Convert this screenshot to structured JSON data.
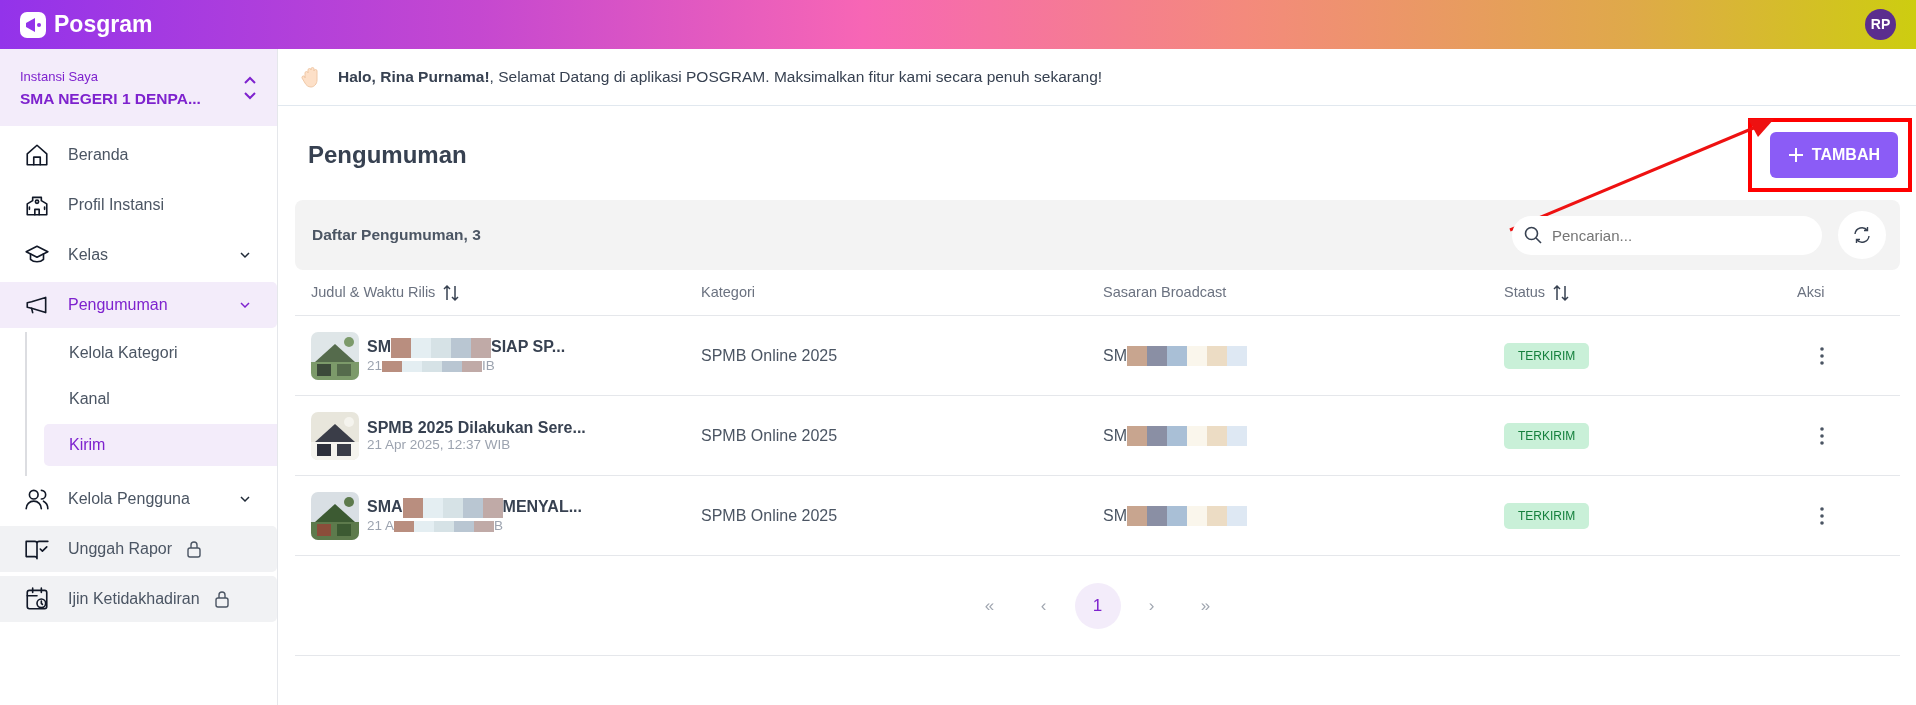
{
  "app": {
    "name": "Posgram",
    "avatar": "RP"
  },
  "institution": {
    "label": "Instansi Saya",
    "name": "SMA NEGERI 1 DENPA..."
  },
  "menu": [
    {
      "label": "Beranda",
      "kind": "link",
      "selected": false,
      "locked": false
    },
    {
      "label": "Profil Instansi",
      "kind": "link",
      "selected": false,
      "locked": false
    },
    {
      "label": "Kelas",
      "kind": "group",
      "selected": false,
      "locked": false
    },
    {
      "label": "Pengumuman",
      "kind": "group",
      "selected": true,
      "locked": false,
      "children": [
        {
          "label": "Kelola Kategori",
          "selected": false
        },
        {
          "label": "Kanal",
          "selected": false
        },
        {
          "label": "Kirim",
          "selected": true
        }
      ]
    },
    {
      "label": "Kelola Pengguna",
      "kind": "group",
      "selected": false,
      "locked": false
    },
    {
      "label": "Unggah Rapor",
      "kind": "link",
      "selected": false,
      "locked": true
    },
    {
      "label": "Ijin Ketidakhadiran",
      "kind": "link",
      "selected": false,
      "locked": true
    }
  ],
  "greeting": "**Halo, Rina Purnama!**, Selamat Datang di aplikasi POSGRAM. Maksimalkan fitur kami secara penuh sekarang!",
  "page_title": "Pengumuman",
  "add_button": "TAMBAH",
  "list_title": "Daftar Pengumuman, 3",
  "search": {
    "placeholder": "Pencarian..."
  },
  "table": {
    "columns": [
      {
        "label": "Judul & Waktu Rilis",
        "sortable": true
      },
      {
        "label": "Kategori",
        "sortable": false
      },
      {
        "label": "Sasaran Broadcast",
        "sortable": false
      },
      {
        "label": "Status",
        "sortable": true
      },
      {
        "label": "Aksi",
        "sortable": false
      }
    ],
    "rows": [
      {
        "title_parts": [
          "SM",
          "SIAP SP..."
        ],
        "date_parts": [
          "21",
          "IB"
        ],
        "category": "SPMB Online 2025",
        "target_parts": [
          "SM"
        ],
        "status": "TERKIRIM"
      },
      {
        "title_parts": [
          "SPMB 2025 Dilakukan Sere..."
        ],
        "date_parts": [
          "21 Apr 2025, 12:37 WIB"
        ],
        "category": "SPMB Online 2025",
        "target_parts": [
          "SM"
        ],
        "status": "TERKIRIM"
      },
      {
        "title_parts": [
          "SMA",
          "MENYAL..."
        ],
        "date_parts": [
          "21 A",
          "B"
        ],
        "category": "SPMB Online 2025",
        "target_parts": [
          "SM"
        ],
        "status": "TERKIRIM"
      }
    ]
  },
  "pagination": [
    {
      "label": "«",
      "selected": false,
      "disabled": true
    },
    {
      "label": "‹",
      "selected": false,
      "disabled": true
    },
    {
      "label": "1",
      "selected": true,
      "disabled": false
    },
    {
      "label": "›",
      "selected": false,
      "disabled": true
    },
    {
      "label": "»",
      "selected": false,
      "disabled": true
    }
  ]
}
